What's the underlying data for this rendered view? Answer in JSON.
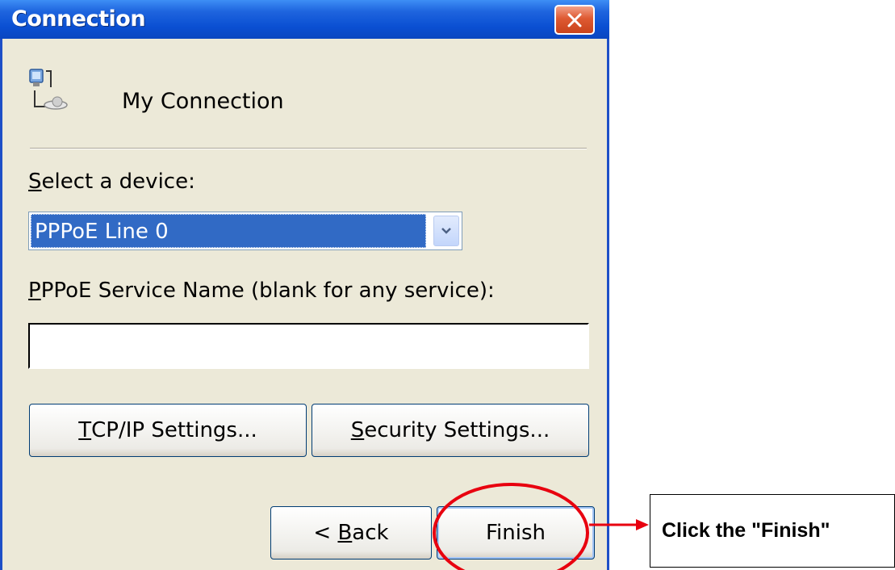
{
  "window": {
    "title": "Connection",
    "connection_name": "My Connection"
  },
  "device": {
    "label_accel": "S",
    "label_rest": "elect a device:",
    "selected": "PPPoE Line 0"
  },
  "service": {
    "label_accel": "P",
    "label_rest": "PPoE Service Name (blank for any service):",
    "value": ""
  },
  "buttons": {
    "tcp_accel": "T",
    "tcp_rest": "CP/IP Settings...",
    "security_accel": "S",
    "security_rest": "ecurity Settings...",
    "back_prefix": "< ",
    "back_accel": "B",
    "back_rest": "ack",
    "finish": "Finish"
  },
  "annotation": {
    "callout_text": "Click the \"Finish\""
  },
  "colors": {
    "titlebar": "#0a4fd2",
    "selection": "#316ac5",
    "annotation_red": "#e8000f"
  },
  "icons": [
    "network-connection-icon",
    "close-icon",
    "chevron-down-icon",
    "arrow-right-icon"
  ]
}
